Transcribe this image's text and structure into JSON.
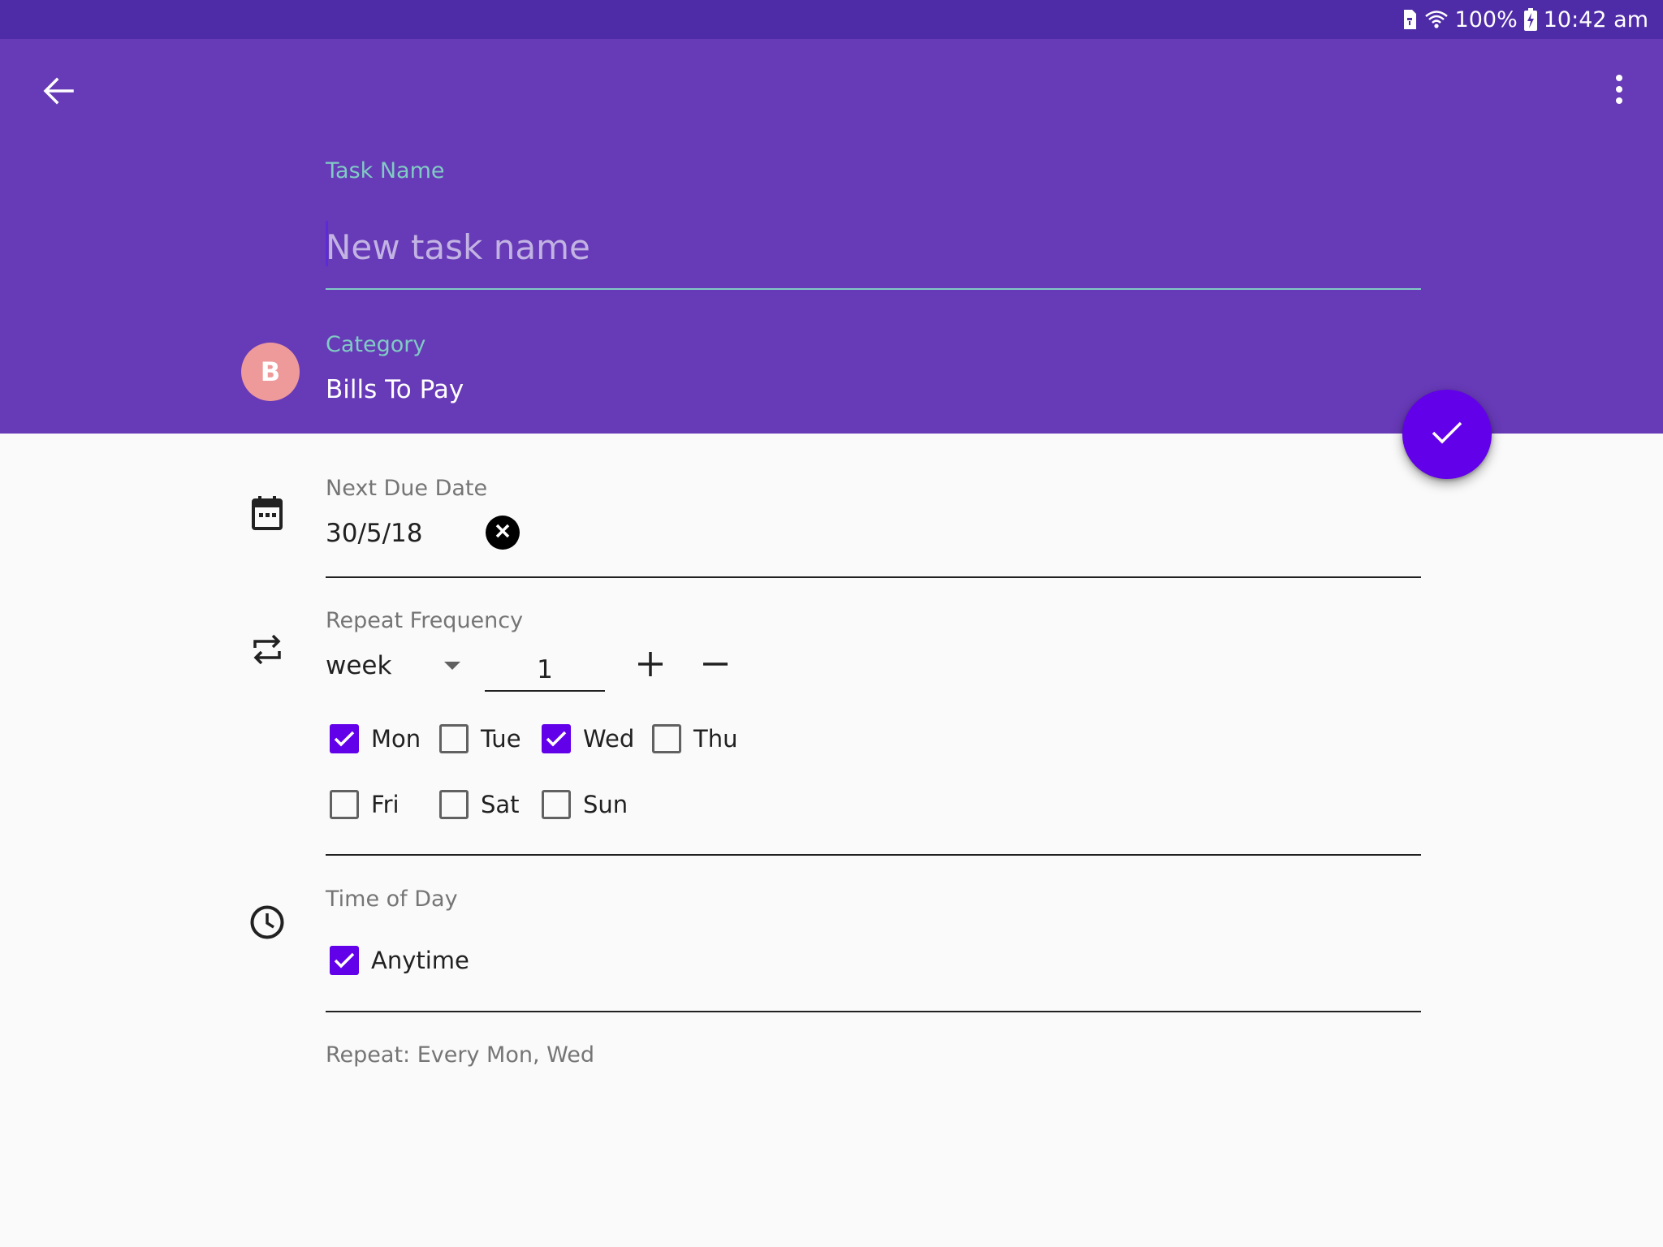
{
  "status_bar": {
    "battery_text": "100%",
    "time": "10:42 am",
    "icons": [
      "sim-card-icon",
      "wifi-icon",
      "battery-charging-icon"
    ]
  },
  "app_bar": {
    "back_icon": "arrow-back-icon",
    "overflow_icon": "more-vert-icon"
  },
  "task_name": {
    "label": "Task Name",
    "value": "",
    "placeholder": "New task name"
  },
  "category": {
    "label": "Category",
    "avatar_letter": "B",
    "value": "Bills To Pay"
  },
  "fab": {
    "icon": "check-icon"
  },
  "due_date": {
    "label": "Next Due Date",
    "value": "30/5/18",
    "icon": "calendar-icon",
    "clear_icon": "clear-icon"
  },
  "repeat": {
    "label": "Repeat Frequency",
    "icon": "repeat-icon",
    "unit": "week",
    "count": "1",
    "days": [
      {
        "label": "Mon",
        "checked": true
      },
      {
        "label": "Tue",
        "checked": false
      },
      {
        "label": "Wed",
        "checked": true
      },
      {
        "label": "Thu",
        "checked": false
      },
      {
        "label": "Fri",
        "checked": false
      },
      {
        "label": "Sat",
        "checked": false
      },
      {
        "label": "Sun",
        "checked": false
      }
    ]
  },
  "time_of_day": {
    "label": "Time of Day",
    "icon": "clock-icon",
    "anytime_label": "Anytime",
    "anytime_checked": true
  },
  "summary": "Repeat: Every Mon, Wed",
  "colors": {
    "status_bar": "#4f2ca7",
    "app_bar": "#673ab7",
    "accent": "#6200ea",
    "label_accent": "#80cbc4",
    "avatar": "#ef9a9a"
  }
}
